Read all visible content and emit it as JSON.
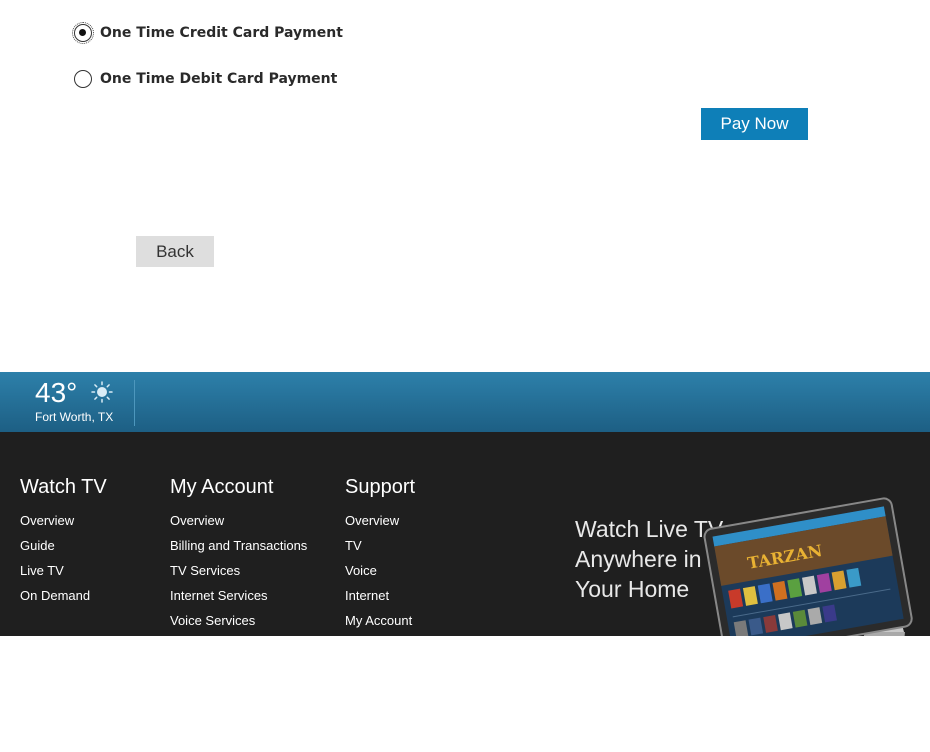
{
  "payment": {
    "options": [
      {
        "label": "One Time Credit Card Payment",
        "selected": true
      },
      {
        "label": "One Time Debit Card Payment",
        "selected": false
      }
    ],
    "pay_now_label": "Pay Now",
    "back_label": "Back"
  },
  "weather": {
    "temperature": "43°",
    "location": "Fort Worth, TX",
    "icon": "sun-icon"
  },
  "footer": {
    "columns": [
      {
        "title": "Watch TV",
        "links": [
          "Overview",
          "Guide",
          "Live TV",
          "On Demand"
        ]
      },
      {
        "title": "My Account",
        "links": [
          "Overview",
          "Billing and Transactions",
          "TV Services",
          "Internet Services",
          "Voice Services"
        ]
      },
      {
        "title": "Support",
        "links": [
          "Overview",
          "TV",
          "Voice",
          "Internet",
          "My Account"
        ]
      }
    ],
    "promo": {
      "lines": [
        "Watch Live TV",
        "Anywhere in",
        "Your Home"
      ],
      "tablet_title": "TARZAN"
    }
  },
  "colors": {
    "accent": "#0e7fb8",
    "weather_bar": "#2470a0",
    "footer_bg": "#1f1f1f"
  }
}
